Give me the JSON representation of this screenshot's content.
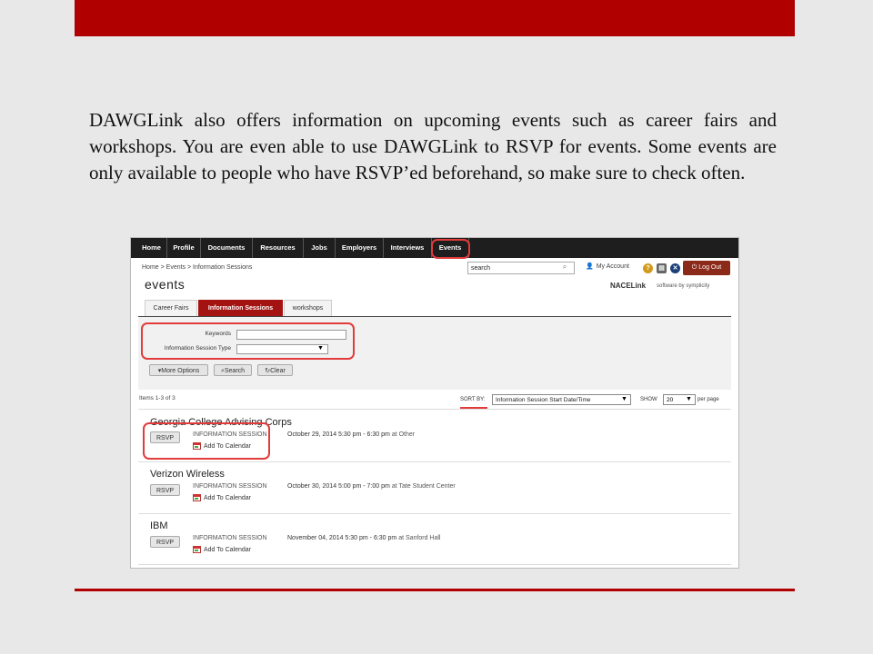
{
  "slide": {
    "intro": "DAWGLink also offers information on upcoming events such as career fairs and workshops. You are even able to use DAWGLink to RSVP for events. Some events are only available to people who have RSVP’ed beforehand, so make sure to check often."
  },
  "nav": {
    "items": [
      "Home",
      "Profile",
      "Documents",
      "Resources",
      "Jobs",
      "Employers",
      "Interviews",
      "Events"
    ]
  },
  "header": {
    "breadcrumb": "Home > Events > Information Sessions",
    "search_value": "search",
    "my_account": "My Account",
    "logout": "Log Out",
    "page_title": "events",
    "brand_nace": "NACELink",
    "brand_symplicity": "software by symplicity"
  },
  "tabs": [
    "Career Fairs",
    "Information Sessions",
    "workshops"
  ],
  "filters": {
    "keywords_label": "Keywords",
    "type_label": "Information Session Type",
    "more_options": "More Options",
    "search": "Search",
    "clear": "Clear"
  },
  "results": {
    "count": "Items 1-3 of 3",
    "sort_by_label": "SORT BY:",
    "sort_by_value": "Information Session Start Date/Time",
    "show_label": "SHOW",
    "show_value": "20",
    "per_page": "per page"
  },
  "events": [
    {
      "title": "Georgia College Advising Corps",
      "type": "INFORMATION SESSION",
      "date": "October 29, 2014 5:30 pm - 6:30 pm",
      "location": "at Other",
      "rsvp": "RSVP",
      "calendar": "Add To Calendar"
    },
    {
      "title": "Verizon Wireless",
      "type": "INFORMATION SESSION",
      "date": "October 30, 2014 5:00 pm - 7:00 pm",
      "location": "at Tate Student Center",
      "rsvp": "RSVP",
      "calendar": "Add To Calendar"
    },
    {
      "title": "IBM",
      "type": "INFORMATION SESSION",
      "date": "November 04, 2014 5:30 pm - 6:30 pm",
      "location": "at Sanford Hall",
      "rsvp": "RSVP",
      "calendar": "Add To Calendar"
    }
  ],
  "colors": {
    "slide_red": "#b00000",
    "highlight": "#e23b3b",
    "active_tab": "#a51212"
  }
}
